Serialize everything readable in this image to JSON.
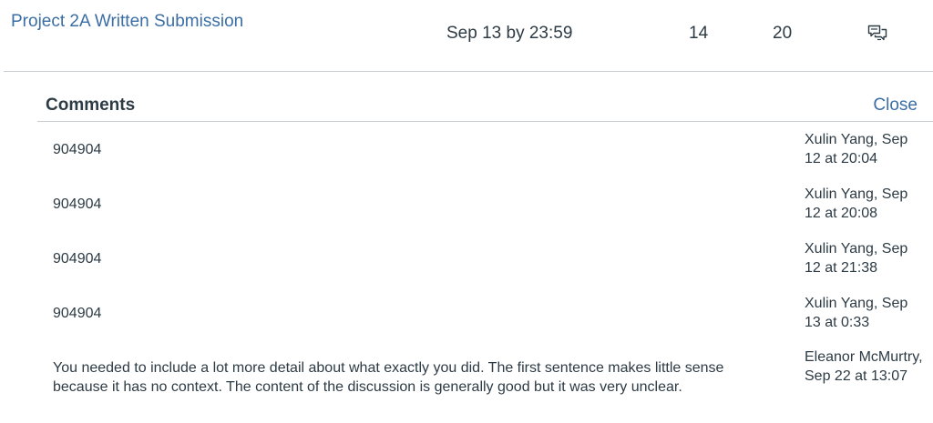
{
  "assignment": {
    "title": "Project 2A Written Submission",
    "due": "Sep 13 by 23:59",
    "score": "14",
    "out_of": "20",
    "comment_icon": "comment-bubbles-icon"
  },
  "comments_panel": {
    "heading": "Comments",
    "close_label": "Close",
    "comments": [
      {
        "text": "904904",
        "author_date": "Xulin Yang, Sep 12 at 20:04"
      },
      {
        "text": "904904",
        "author_date": "Xulin Yang, Sep 12 at 20:08"
      },
      {
        "text": "904904",
        "author_date": "Xulin Yang, Sep 12 at 21:38"
      },
      {
        "text": "904904",
        "author_date": "Xulin Yang, Sep 13 at 0:33"
      },
      {
        "text": "You needed to include a lot more detail about what exactly you did. The first sentence makes little sense because it has no context. The content of the discussion is generally good but it was very unclear.",
        "author_date": "Eleanor McMurtry, Sep 22 at 13:07"
      }
    ]
  },
  "colors": {
    "link": "#3a6ea5",
    "text": "#2d3b45",
    "divider": "#c7cdd1"
  }
}
